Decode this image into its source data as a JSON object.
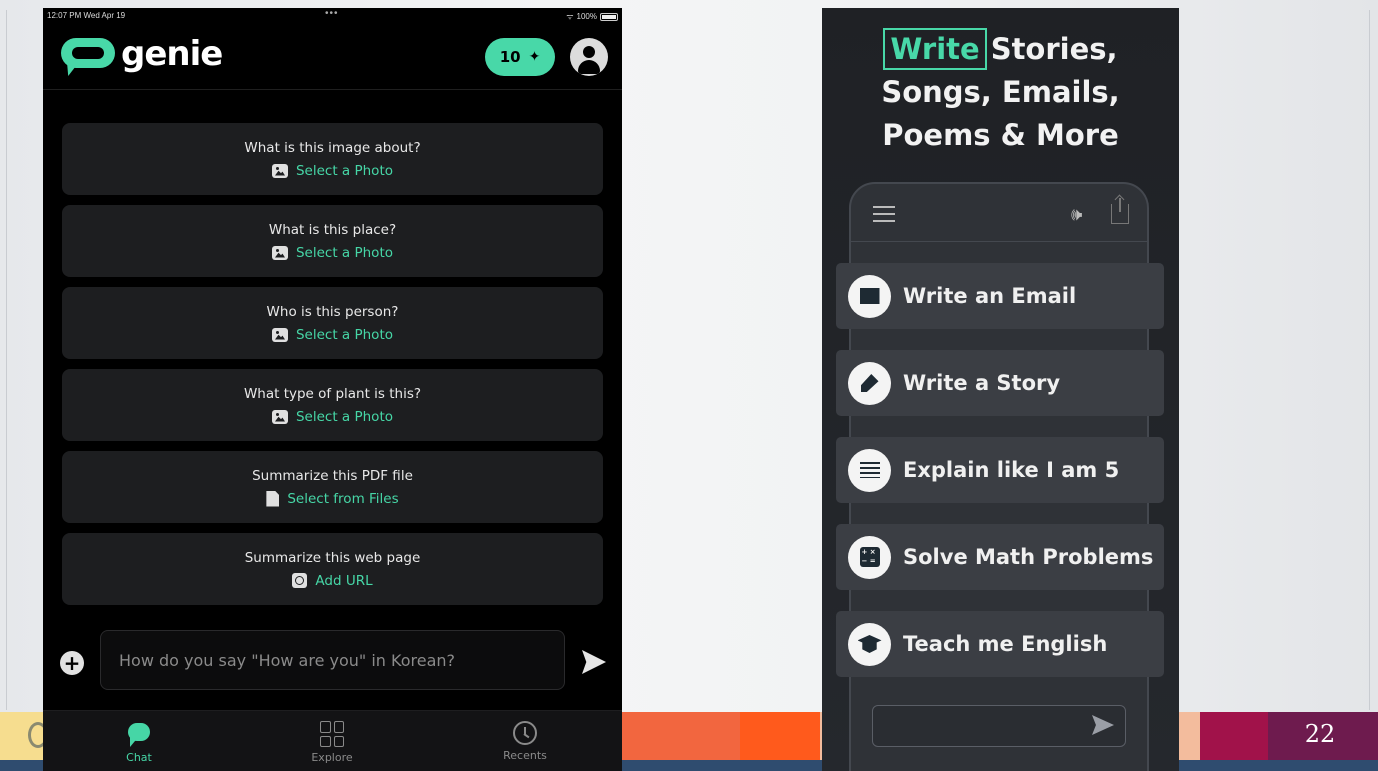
{
  "slide": {
    "page_number": "22",
    "band_colors": [
      "#f6dd8f",
      "#f1e6b5",
      "#e9bf55",
      "#f2663f",
      "#ff5a1c",
      "#f3bc9d",
      "#a1124a",
      "#6e1b4e"
    ]
  },
  "left_app": {
    "status": {
      "time": "12:07 PM  Wed Apr 19",
      "dots": "•••",
      "wifi": "ᯤ",
      "battery": "100%"
    },
    "brand": "genie",
    "credits": "10",
    "credits_icon": "✦",
    "cards": [
      {
        "question": "What is this image about?",
        "action": "Select a Photo",
        "icon": "photo-icon"
      },
      {
        "question": "What is this place?",
        "action": "Select a Photo",
        "icon": "photo-icon"
      },
      {
        "question": "Who is this person?",
        "action": "Select a Photo",
        "icon": "photo-icon"
      },
      {
        "question": "What type of plant is this?",
        "action": "Select a Photo",
        "icon": "photo-icon"
      },
      {
        "question": "Summarize this PDF file",
        "action": "Select from Files",
        "icon": "file-icon"
      },
      {
        "question": "Summarize this web page",
        "action": "Add URL",
        "icon": "link-icon"
      }
    ],
    "composer": {
      "plus": "+",
      "placeholder": "How do you say \"How are you\" in Korean?"
    },
    "tabs": {
      "chat": "Chat",
      "explore": "Explore",
      "recents": "Recents"
    },
    "accent": "#46d6a6"
  },
  "right_promo": {
    "headline_highlight": "Write",
    "headline_line1_rest": "Stories,",
    "headline_line2": "Songs, Emails,",
    "headline_line3": "Poems & More",
    "speaker_icon": "🕪",
    "prompts": [
      {
        "label": "Write an Email",
        "icon": "mail-icon"
      },
      {
        "label": "Write a Story",
        "icon": "pen-icon"
      },
      {
        "label": "Explain like I am 5",
        "icon": "text-lines-icon"
      },
      {
        "label": "Solve Math Problems",
        "icon": "calculator-icon"
      },
      {
        "label": "Teach me English",
        "icon": "graduation-cap-icon"
      }
    ]
  }
}
